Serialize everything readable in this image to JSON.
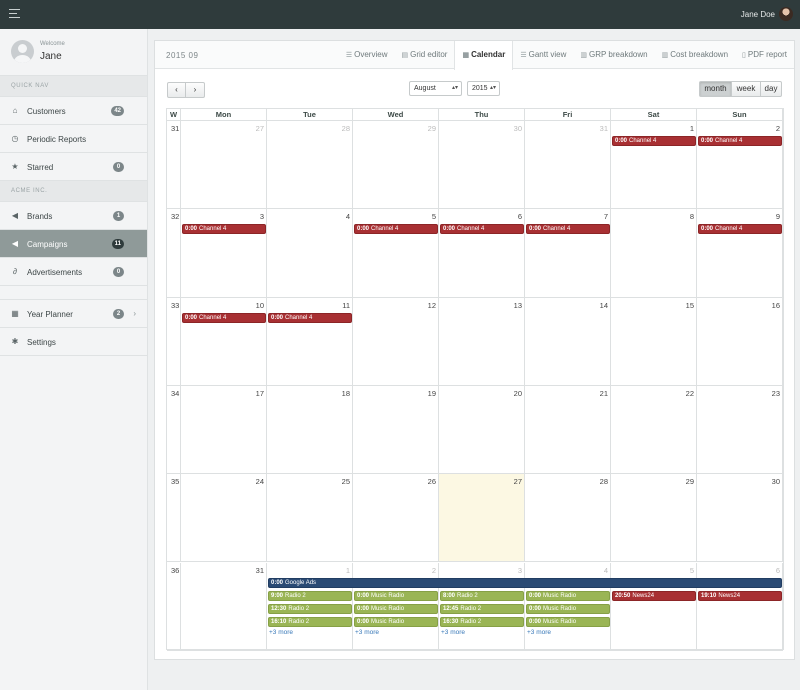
{
  "topbar": {
    "username": "Jane Doe"
  },
  "user": {
    "welcome": "Welcome",
    "name": "Jane"
  },
  "sidebar": {
    "sections": [
      {
        "label": "QUICK NAV",
        "items": [
          {
            "key": "customers",
            "icon": "home-icon",
            "glyph": "⌂",
            "label": "Customers",
            "badge": "42"
          },
          {
            "key": "periodic-reports",
            "icon": "clock-icon",
            "glyph": "◷",
            "label": "Periodic Reports",
            "badge": null
          },
          {
            "key": "starred",
            "icon": "star-icon",
            "glyph": "★",
            "label": "Starred",
            "badge": "0"
          }
        ]
      },
      {
        "label": "ACME INC.",
        "items": [
          {
            "key": "brands",
            "icon": "bullhorn-icon",
            "glyph": "◀",
            "label": "Brands",
            "badge": "1"
          },
          {
            "key": "campaigns",
            "icon": "bullhorn-icon",
            "glyph": "◀",
            "label": "Campaigns",
            "badge": "11",
            "active": true
          },
          {
            "key": "advertisements",
            "icon": "paperclip-icon",
            "glyph": "∂",
            "label": "Advertisements",
            "badge": "0"
          }
        ]
      },
      {
        "label": null,
        "items": [
          {
            "key": "year-planner",
            "icon": "calendar-icon",
            "glyph": "▦",
            "label": "Year Planner",
            "badge": "2",
            "chevron": true
          },
          {
            "key": "settings",
            "icon": "gear-icon",
            "glyph": "✱",
            "label": "Settings",
            "badge": null
          }
        ]
      }
    ]
  },
  "panel": {
    "date_label": "2015 09",
    "tabs": [
      {
        "key": "overview",
        "icon": "list-icon",
        "glyph": "☰",
        "label": "Overview"
      },
      {
        "key": "grid-editor",
        "icon": "grid-icon",
        "glyph": "▤",
        "label": "Grid editor"
      },
      {
        "key": "calendar",
        "icon": "calendar-icon",
        "glyph": "▦",
        "label": "Calendar",
        "active": true
      },
      {
        "key": "gantt-view",
        "icon": "tasks-icon",
        "glyph": "☰",
        "label": "Gantt view"
      },
      {
        "key": "grp-breakdown",
        "icon": "bar-chart-icon",
        "glyph": "▥",
        "label": "GRP breakdown"
      },
      {
        "key": "cost-breakdown",
        "icon": "bar-chart-icon",
        "glyph": "▥",
        "label": "Cost breakdown"
      },
      {
        "key": "pdf-report",
        "icon": "file-icon",
        "glyph": "▯",
        "label": "PDF report"
      }
    ]
  },
  "toolbar": {
    "prev": "‹",
    "next": "›",
    "month_value": "August",
    "year_value": "2015",
    "select_arrow": "▴▾",
    "modes": {
      "month": "month",
      "week": "week",
      "day": "day"
    },
    "active_mode": "month"
  },
  "calendar": {
    "headers": [
      "W",
      "Mon",
      "Tue",
      "Wed",
      "Thu",
      "Fri",
      "Sat",
      "Sun"
    ],
    "weeks": [
      {
        "num": "31",
        "days": [
          {
            "d": "27",
            "o": true
          },
          {
            "d": "28",
            "o": true
          },
          {
            "d": "29",
            "o": true
          },
          {
            "d": "30",
            "o": true
          },
          {
            "d": "31",
            "o": true
          },
          {
            "d": "1"
          },
          {
            "d": "2"
          }
        ]
      },
      {
        "num": "32",
        "days": [
          {
            "d": "3"
          },
          {
            "d": "4"
          },
          {
            "d": "5"
          },
          {
            "d": "6"
          },
          {
            "d": "7"
          },
          {
            "d": "8"
          },
          {
            "d": "9"
          }
        ]
      },
      {
        "num": "33",
        "days": [
          {
            "d": "10"
          },
          {
            "d": "11"
          },
          {
            "d": "12"
          },
          {
            "d": "13"
          },
          {
            "d": "14"
          },
          {
            "d": "15"
          },
          {
            "d": "16"
          }
        ]
      },
      {
        "num": "34",
        "days": [
          {
            "d": "17"
          },
          {
            "d": "18"
          },
          {
            "d": "19"
          },
          {
            "d": "20"
          },
          {
            "d": "21"
          },
          {
            "d": "22"
          },
          {
            "d": "23"
          }
        ]
      },
      {
        "num": "35",
        "days": [
          {
            "d": "24"
          },
          {
            "d": "25"
          },
          {
            "d": "26"
          },
          {
            "d": "27",
            "today": true
          },
          {
            "d": "28"
          },
          {
            "d": "29"
          },
          {
            "d": "30"
          }
        ]
      },
      {
        "num": "36",
        "days": [
          {
            "d": "31"
          },
          {
            "d": "1",
            "o": true
          },
          {
            "d": "2",
            "o": true
          },
          {
            "d": "3",
            "o": true
          },
          {
            "d": "4",
            "o": true
          },
          {
            "d": "5",
            "o": true
          },
          {
            "d": "6",
            "o": true
          }
        ]
      }
    ],
    "events": [
      {
        "week": 0,
        "day": 5,
        "span": 1,
        "slot": 0,
        "time": "0:00",
        "title": "Channel 4",
        "color": "red"
      },
      {
        "week": 0,
        "day": 6,
        "span": 1,
        "slot": 0,
        "time": "0:00",
        "title": "Channel 4",
        "color": "red"
      },
      {
        "week": 1,
        "day": 0,
        "span": 1,
        "slot": 0,
        "time": "0:00",
        "title": "Channel 4",
        "color": "red"
      },
      {
        "week": 1,
        "day": 2,
        "span": 1,
        "slot": 0,
        "time": "0:00",
        "title": "Channel 4",
        "color": "red"
      },
      {
        "week": 1,
        "day": 3,
        "span": 1,
        "slot": 0,
        "time": "0:00",
        "title": "Channel 4",
        "color": "red"
      },
      {
        "week": 1,
        "day": 4,
        "span": 1,
        "slot": 0,
        "time": "0:00",
        "title": "Channel 4",
        "color": "red"
      },
      {
        "week": 1,
        "day": 6,
        "span": 1,
        "slot": 0,
        "time": "0:00",
        "title": "Channel 4",
        "color": "red"
      },
      {
        "week": 2,
        "day": 0,
        "span": 1,
        "slot": 0,
        "time": "0:00",
        "title": "Channel 4",
        "color": "red"
      },
      {
        "week": 2,
        "day": 1,
        "span": 1,
        "slot": 0,
        "time": "0:00",
        "title": "Channel 4",
        "color": "red"
      },
      {
        "week": 5,
        "day": 1,
        "span": 6,
        "slot": 0,
        "time": "0:00",
        "title": "Google Ads",
        "color": "navy"
      },
      {
        "week": 5,
        "day": 1,
        "span": 1,
        "slot": 1,
        "time": "9:00",
        "title": "Radio 2",
        "color": "green"
      },
      {
        "week": 5,
        "day": 1,
        "span": 1,
        "slot": 2,
        "time": "12:30",
        "title": "Radio 2",
        "color": "green"
      },
      {
        "week": 5,
        "day": 1,
        "span": 1,
        "slot": 3,
        "time": "16:10",
        "title": "Radio 2",
        "color": "green"
      },
      {
        "week": 5,
        "day": 2,
        "span": 1,
        "slot": 1,
        "time": "0:00",
        "title": "Music Radio",
        "color": "green"
      },
      {
        "week": 5,
        "day": 2,
        "span": 1,
        "slot": 2,
        "time": "0:00",
        "title": "Music Radio",
        "color": "green"
      },
      {
        "week": 5,
        "day": 2,
        "span": 1,
        "slot": 3,
        "time": "0:00",
        "title": "Music Radio",
        "color": "green"
      },
      {
        "week": 5,
        "day": 3,
        "span": 1,
        "slot": 1,
        "time": "8:00",
        "title": "Radio 2",
        "color": "green"
      },
      {
        "week": 5,
        "day": 3,
        "span": 1,
        "slot": 2,
        "time": "12:45",
        "title": "Radio 2",
        "color": "green"
      },
      {
        "week": 5,
        "day": 3,
        "span": 1,
        "slot": 3,
        "time": "16:30",
        "title": "Radio 2",
        "color": "green"
      },
      {
        "week": 5,
        "day": 4,
        "span": 1,
        "slot": 1,
        "time": "0:00",
        "title": "Music Radio",
        "color": "green"
      },
      {
        "week": 5,
        "day": 4,
        "span": 1,
        "slot": 2,
        "time": "0:00",
        "title": "Music Radio",
        "color": "green"
      },
      {
        "week": 5,
        "day": 4,
        "span": 1,
        "slot": 3,
        "time": "0:00",
        "title": "Music Radio",
        "color": "green"
      },
      {
        "week": 5,
        "day": 5,
        "span": 1,
        "slot": 1,
        "time": "20:50",
        "title": "News24",
        "color": "red"
      },
      {
        "week": 5,
        "day": 6,
        "span": 1,
        "slot": 1,
        "time": "19:10",
        "title": "News24",
        "color": "red"
      }
    ],
    "more_links": [
      {
        "week": 5,
        "day": 1,
        "label": "+3 more"
      },
      {
        "week": 5,
        "day": 2,
        "label": "+3 more"
      },
      {
        "week": 5,
        "day": 3,
        "label": "+3 more"
      },
      {
        "week": 5,
        "day": 4,
        "label": "+3 more"
      }
    ]
  },
  "colors": {
    "red": "#a83033",
    "green": "#9ab555",
    "navy": "#2a4a74",
    "today": "#fcf8e3",
    "sidebar_active": "#8f9a99"
  }
}
